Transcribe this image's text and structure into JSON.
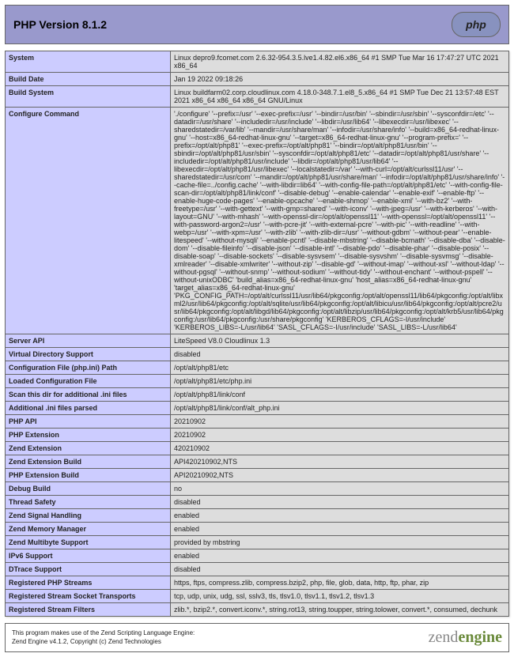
{
  "header": {
    "title": "PHP Version 8.1.2",
    "logo": "php"
  },
  "rows": [
    {
      "k": "System",
      "v": "Linux depro9.fcomet.com 2.6.32-954.3.5.lve1.4.82.el6.x86_64 #1 SMP Tue Mar 16 17:47:27 UTC 2021 x86_64"
    },
    {
      "k": "Build Date",
      "v": "Jan 19 2022 09:18:26"
    },
    {
      "k": "Build System",
      "v": "Linux buildfarm02.corp.cloudlinux.com 4.18.0-348.7.1.el8_5.x86_64 #1 SMP Tue Dec 21 13:57:48 EST 2021 x86_64 x86_64 x86_64 GNU/Linux"
    },
    {
      "k": "Configure Command",
      "v": "'./configure' '--prefix=/usr' '--exec-prefix=/usr' '--bindir=/usr/bin' '--sbindir=/usr/sbin' '--sysconfdir=/etc' '--datadir=/usr/share' '--includedir=/usr/include' '--libdir=/usr/lib64' '--libexecdir=/usr/libexec' '--sharedstatedir=/var/lib' '--mandir=/usr/share/man' '--infodir=/usr/share/info' '--build=x86_64-redhat-linux-gnu' '--host=x86_64-redhat-linux-gnu' '--target=x86_64-redhat-linux-gnu' '--program-prefix=' '--prefix=/opt/alt/php81' '--exec-prefix=/opt/alt/php81' '--bindir=/opt/alt/php81/usr/bin' '--sbindir=/opt/alt/php81/usr/sbin' '--sysconfdir=/opt/alt/php81/etc' '--datadir=/opt/alt/php81/usr/share' '--includedir=/opt/alt/php81/usr/include' '--libdir=/opt/alt/php81/usr/lib64' '--libexecdir=/opt/alt/php81/usr/libexec' '--localstatedir=/var' '--with-curl=/opt/alt/curlssl11/usr' '--sharedstatedir=/usr/com' '--mandir=/opt/alt/php81/usr/share/man' '--infodir=/opt/alt/php81/usr/share/info' '--cache-file=../config.cache' '--with-libdir=lib64' '--with-config-file-path=/opt/alt/php81/etc' '--with-config-file-scan-dir=/opt/alt/php81/link/conf' '--disable-debug' '--enable-calendar' '--enable-exif' '--enable-ftp' '--enable-huge-code-pages' '--enable-opcache' '--enable-shmop' '--enable-xml' '--with-bz2' '--with-freetype=/usr' '--with-gettext' '--with-gmp=shared' '--with-iconv' '--with-jpeg=/usr' '--with-kerberos' '--with-layout=GNU' '--with-mhash' '--with-openssl-dir=/opt/alt/openssl11' '--with-openssl=/opt/alt/openssl11' '--with-password-argon2=/usr' '--with-pcre-jit' '--with-external-pcre' '--with-pic' '--with-readline' '--with-webp=/usr' '--with-xpm=/usr' '--with-zlib' '--with-zlib-dir=/usr' '--without-gdbm' '--without-pear' '--enable-litespeed' '--without-mysqli' '--enable-pcntl' '--disable-mbstring' '--disable-bcmath' '--disable-dba' '--disable-dom' '--disable-fileinfo' '--disable-json' '--disable-intl' '--disable-pdo' '--disable-phar' '--disable-posix' '--disable-soap' '--disable-sockets' '--disable-sysvsem' '--disable-sysvshm' '--disable-sysvmsg' '--disable-xmlreader' '--disable-xmlwriter' '--without-zip' '--disable-gd' '--without-imap' '--without-xsl' '--without-ldap' '--without-pgsql' '--without-snmp' '--without-sodium' '--without-tidy' '--without-enchant' '--without-pspell' '--without-unixODBC' 'build_alias=x86_64-redhat-linux-gnu' 'host_alias=x86_64-redhat-linux-gnu' 'target_alias=x86_64-redhat-linux-gnu' 'PKG_CONFIG_PATH=/opt/alt/curlssl11/usr/lib64/pkgconfig:/opt/alt/openssl11/lib64/pkgconfig:/opt/alt/libxml2/usr/lib64/pkgconfig:/opt/alt/sqlite/usr/lib64/pkgconfig:/opt/alt/libicu/usr/lib64/pkgconfig:/opt/alt/pcre2/usr/lib64/pkgconfig:/opt/alt/libgd/lib64/pkgconfig:/opt/alt/libzip/usr/lib64/pkgconfig:/opt/alt/krb5/usr/lib64/pkgconfig:/usr/lib64/pkgconfig:/usr/share/pkgconfig' 'KERBEROS_CFLAGS=-I/usr/include' 'KERBEROS_LIBS=-L/usr/lib64' 'SASL_CFLAGS=-I/usr/include' 'SASL_LIBS=-L/usr/lib64'"
    },
    {
      "k": "Server API",
      "v": "LiteSpeed V8.0 Cloudlinux 1.3"
    },
    {
      "k": "Virtual Directory Support",
      "v": "disabled"
    },
    {
      "k": "Configuration File (php.ini) Path",
      "v": "/opt/alt/php81/etc"
    },
    {
      "k": "Loaded Configuration File",
      "v": "/opt/alt/php81/etc/php.ini"
    },
    {
      "k": "Scan this dir for additional .ini files",
      "v": "/opt/alt/php81/link/conf"
    },
    {
      "k": "Additional .ini files parsed",
      "v": "/opt/alt/php81/link/conf/alt_php.ini"
    },
    {
      "k": "PHP API",
      "v": "20210902"
    },
    {
      "k": "PHP Extension",
      "v": "20210902"
    },
    {
      "k": "Zend Extension",
      "v": "420210902"
    },
    {
      "k": "Zend Extension Build",
      "v": "API420210902,NTS"
    },
    {
      "k": "PHP Extension Build",
      "v": "API20210902,NTS"
    },
    {
      "k": "Debug Build",
      "v": "no"
    },
    {
      "k": "Thread Safety",
      "v": "disabled"
    },
    {
      "k": "Zend Signal Handling",
      "v": "enabled"
    },
    {
      "k": "Zend Memory Manager",
      "v": "enabled"
    },
    {
      "k": "Zend Multibyte Support",
      "v": "provided by mbstring"
    },
    {
      "k": "IPv6 Support",
      "v": "enabled"
    },
    {
      "k": "DTrace Support",
      "v": "disabled"
    },
    {
      "k": "Registered PHP Streams",
      "v": "https, ftps, compress.zlib, compress.bzip2, php, file, glob, data, http, ftp, phar, zip"
    },
    {
      "k": "Registered Stream Socket Transports",
      "v": "tcp, udp, unix, udg, ssl, sslv3, tls, tlsv1.0, tlsv1.1, tlsv1.2, tlsv1.3"
    },
    {
      "k": "Registered Stream Filters",
      "v": "zlib.*, bzip2.*, convert.iconv.*, string.rot13, string.toupper, string.tolower, convert.*, consumed, dechunk"
    }
  ],
  "footer": {
    "line1": "This program makes use of the Zend Scripting Language Engine:",
    "line2": "Zend Engine v4.1.2, Copyright (c) Zend Technologies",
    "logo": "zend",
    "logo_suffix": "engine"
  }
}
